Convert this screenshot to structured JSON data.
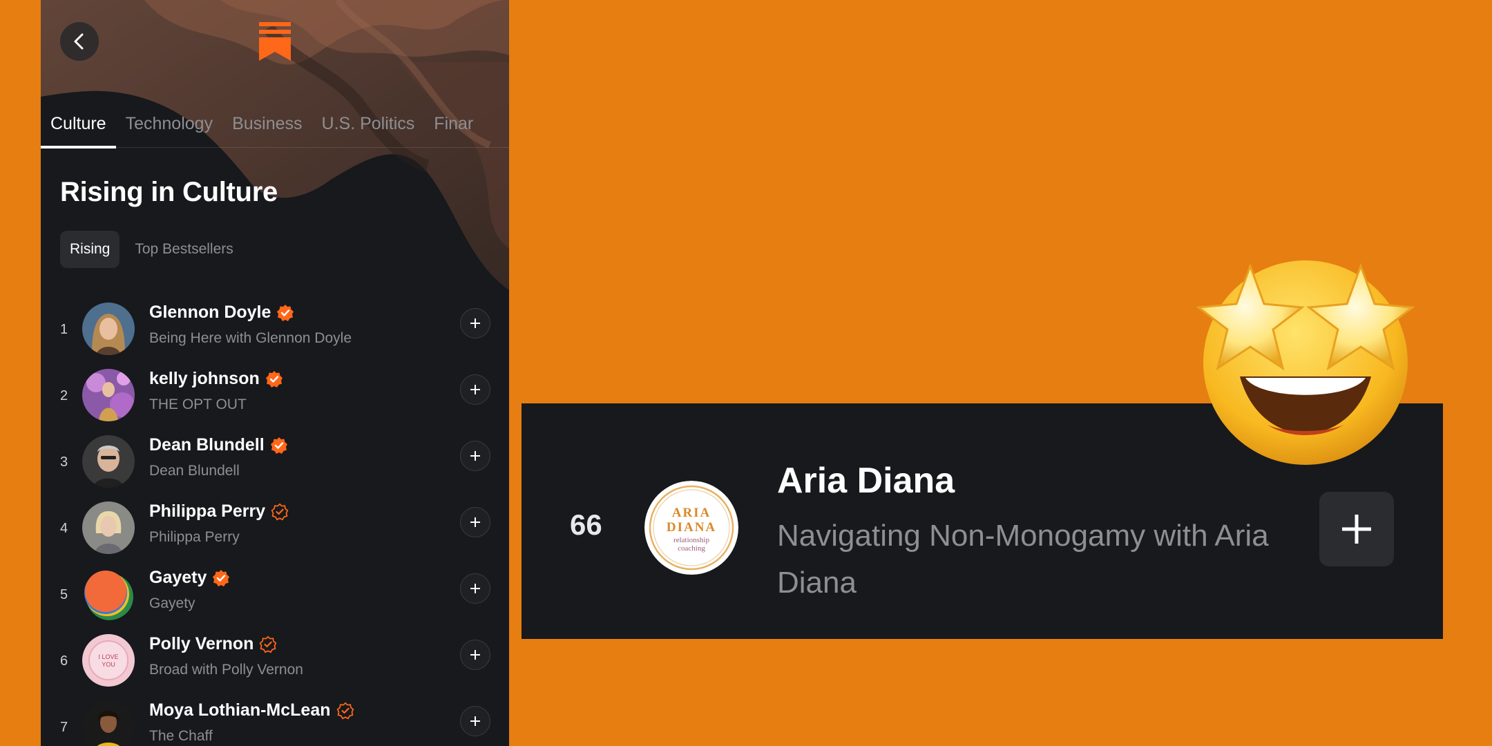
{
  "colors": {
    "background_orange": "#E67E12",
    "panel_dark": "#17191C",
    "brand_orange": "#FF6719",
    "muted_text": "#8E8E93"
  },
  "icons": {
    "back": "chevron-left-icon",
    "logo": "substack-logo",
    "verified": "verified-badge-icon",
    "add": "plus-icon",
    "emoji": "star-struck-emoji"
  },
  "tabs": [
    {
      "label": "Culture",
      "active": true
    },
    {
      "label": "Technology",
      "active": false
    },
    {
      "label": "Business",
      "active": false
    },
    {
      "label": "U.S. Politics",
      "active": false
    },
    {
      "label": "Finar",
      "active": false
    }
  ],
  "section": {
    "title": "Rising in Culture",
    "subtabs": [
      {
        "label": "Rising",
        "active": true
      },
      {
        "label": "Top Bestsellers",
        "active": false
      }
    ]
  },
  "list": [
    {
      "rank": "1",
      "name": "Glennon Doyle",
      "publication": "Being Here with Glennon Doyle",
      "badge": "filled"
    },
    {
      "rank": "2",
      "name": "kelly johnson",
      "publication": "THE OPT OUT",
      "badge": "filled"
    },
    {
      "rank": "3",
      "name": "Dean Blundell",
      "publication": "Dean Blundell",
      "badge": "filled"
    },
    {
      "rank": "4",
      "name": "Philippa Perry",
      "publication": "Philippa Perry",
      "badge": "outline"
    },
    {
      "rank": "5",
      "name": "Gayety",
      "publication": "Gayety",
      "badge": "filled"
    },
    {
      "rank": "6",
      "name": "Polly Vernon",
      "publication": "Broad with Polly Vernon",
      "badge": "outline"
    },
    {
      "rank": "7",
      "name": "Moya Lothian-McLean",
      "publication": "The Chaff",
      "badge": "outline"
    }
  ],
  "polly_avatar_text": "I LOVE YOU",
  "highlight": {
    "rank": "66",
    "name": "Aria Diana",
    "publication": "Navigating Non-Monogamy with Aria Diana",
    "logo_line1": "ARIA",
    "logo_line2": "DIANA",
    "logo_line3": "relationship",
    "logo_line4": "coaching"
  }
}
